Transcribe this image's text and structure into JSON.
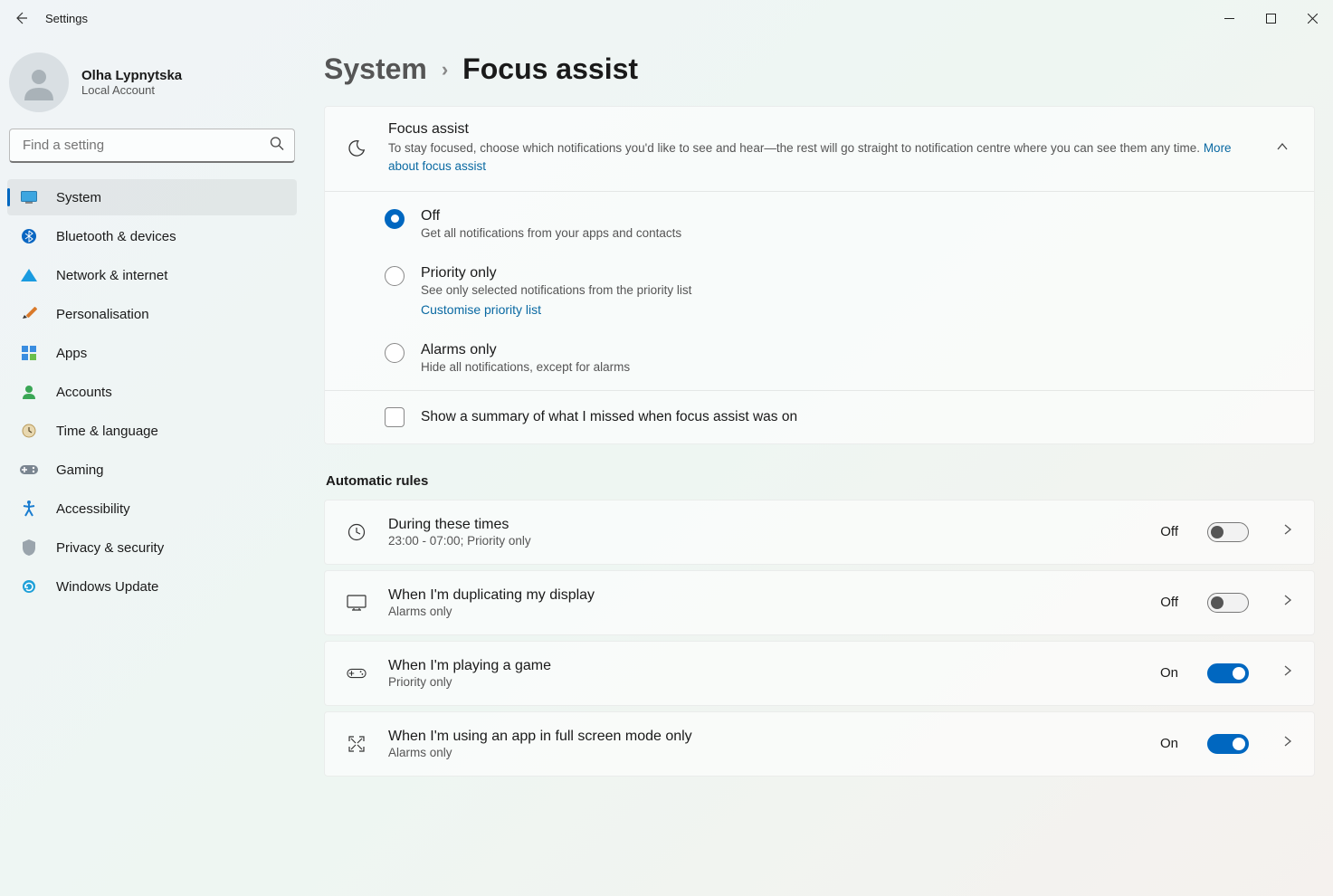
{
  "window": {
    "title": "Settings"
  },
  "profile": {
    "name": "Olha Lypnytska",
    "sub": "Local Account"
  },
  "search": {
    "placeholder": "Find a setting"
  },
  "nav": [
    {
      "label": "System",
      "icon": "system",
      "active": true
    },
    {
      "label": "Bluetooth & devices",
      "icon": "bluetooth"
    },
    {
      "label": "Network & internet",
      "icon": "network"
    },
    {
      "label": "Personalisation",
      "icon": "personalise"
    },
    {
      "label": "Apps",
      "icon": "apps"
    },
    {
      "label": "Accounts",
      "icon": "accounts"
    },
    {
      "label": "Time & language",
      "icon": "time"
    },
    {
      "label": "Gaming",
      "icon": "gaming"
    },
    {
      "label": "Accessibility",
      "icon": "accessibility"
    },
    {
      "label": "Privacy & security",
      "icon": "privacy"
    },
    {
      "label": "Windows Update",
      "icon": "update"
    }
  ],
  "breadcrumb": {
    "parent": "System",
    "current": "Focus assist"
  },
  "focus": {
    "title": "Focus assist",
    "desc": "To stay focused, choose which notifications you'd like to see and hear—the rest will go straight to notification centre where you can see them any time.  ",
    "link": "More about focus assist",
    "options": [
      {
        "title": "Off",
        "sub": "Get all notifications from your apps and contacts",
        "checked": true
      },
      {
        "title": "Priority only",
        "sub": "See only selected notifications from the priority list",
        "checked": false,
        "link": "Customise priority list"
      },
      {
        "title": "Alarms only",
        "sub": "Hide all notifications, except for alarms",
        "checked": false
      }
    ],
    "summary_checkbox": "Show a summary of what I missed when focus assist was on"
  },
  "rules": {
    "heading": "Automatic rules",
    "items": [
      {
        "title": "During these times",
        "sub": "23:00 - 07:00; Priority only",
        "state": "Off",
        "on": false,
        "icon": "clock"
      },
      {
        "title": "When I'm duplicating my display",
        "sub": "Alarms only",
        "state": "Off",
        "on": false,
        "icon": "monitor"
      },
      {
        "title": "When I'm playing a game",
        "sub": "Priority only",
        "state": "On",
        "on": true,
        "icon": "game"
      },
      {
        "title": "When I'm using an app in full screen mode only",
        "sub": "Alarms only",
        "state": "On",
        "on": true,
        "icon": "fullscreen"
      }
    ]
  }
}
